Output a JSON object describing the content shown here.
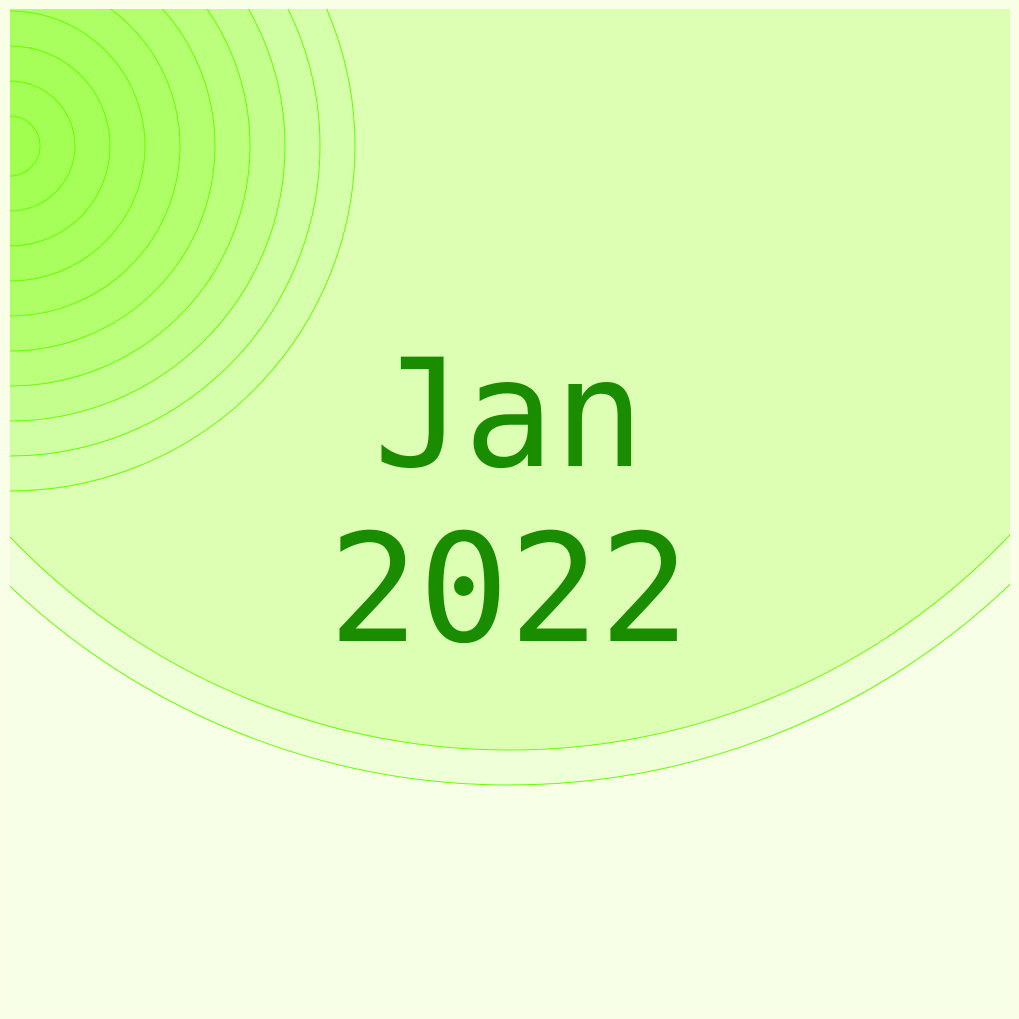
{
  "date": {
    "month": "Jan",
    "year": "2022"
  },
  "colors": {
    "outer_frame": "#f8ffe6",
    "tile_background": "#f7ffe6",
    "big_circle_fill": "#dcffb4",
    "ring_stroke": "#66ff00",
    "quarter_rings_base": "#99ff4d",
    "text": "#1a8c00"
  }
}
